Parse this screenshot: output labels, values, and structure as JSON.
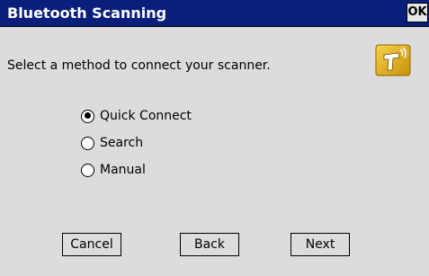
{
  "window": {
    "title": "Bluetooth Scanning",
    "ok_label": "OK"
  },
  "prompt": "Select a method to connect your scanner.",
  "options": [
    {
      "label": "Quick Connect",
      "selected": true
    },
    {
      "label": "Search",
      "selected": false
    },
    {
      "label": "Manual",
      "selected": false
    }
  ],
  "buttons": {
    "cancel": "Cancel",
    "back": "Back",
    "next": "Next"
  },
  "icons": {
    "app": "bluetooth-scanner-icon"
  },
  "colors": {
    "titlebar": "#0a1f7a",
    "background": "#dcdcdc",
    "icon": "#e8b40c"
  }
}
